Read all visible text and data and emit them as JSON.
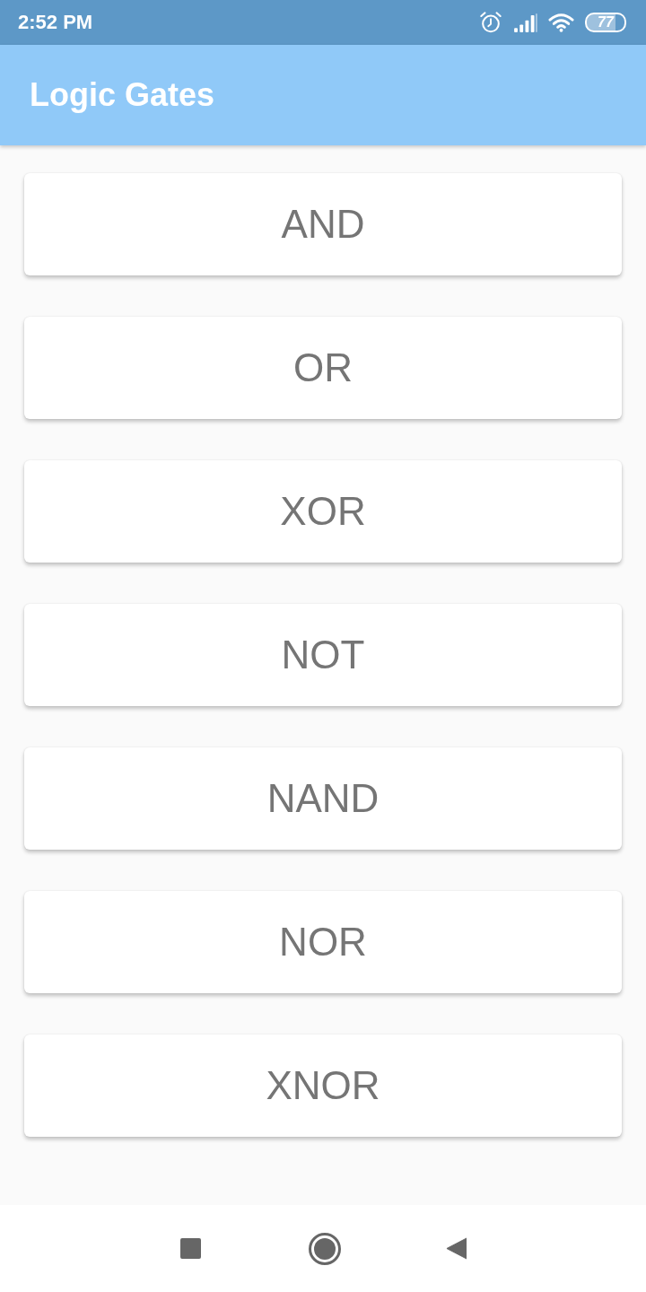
{
  "status_bar": {
    "time": "2:52 PM",
    "battery": "77"
  },
  "app_bar": {
    "title": "Logic Gates"
  },
  "gates": [
    {
      "label": "AND"
    },
    {
      "label": "OR"
    },
    {
      "label": "XOR"
    },
    {
      "label": "NOT"
    },
    {
      "label": "NAND"
    },
    {
      "label": "NOR"
    },
    {
      "label": "XNOR"
    }
  ],
  "nav_bar": {
    "buttons": [
      {
        "kind": "recents"
      },
      {
        "kind": "home"
      },
      {
        "kind": "back"
      }
    ]
  }
}
